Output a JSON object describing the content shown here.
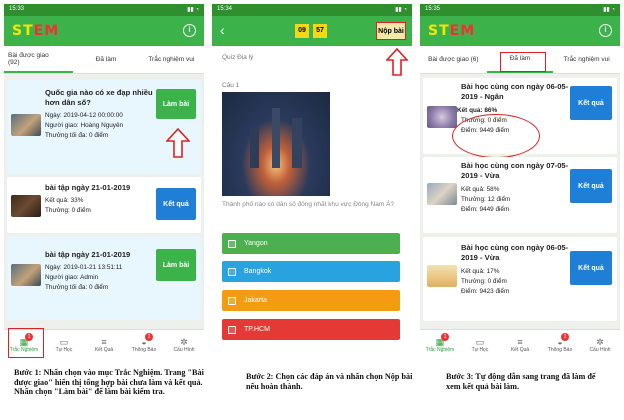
{
  "screen1": {
    "time": "15:33",
    "logo": "STEM",
    "tabs": [
      "Bài được giao\n(92)",
      "Đã làm",
      "Trắc nghiệm vui"
    ],
    "cards": [
      {
        "title": "Quốc gia nào có xe đạp nhiều hơn dân số?",
        "lines": [
          "Ngày: 2019-04-12 00:00:00",
          "Người giao: Hoàng Nguyên",
          "Thưởng tối đa: 0 điểm"
        ],
        "button": "Làm bài"
      },
      {
        "title": "bài tập ngày 21-01-2019",
        "lines": [
          "Kết quả: 33%",
          "Thưởng: 0 điểm"
        ],
        "button": "Kết quả"
      },
      {
        "title": "bài tập ngày 21-01-2019",
        "lines": [
          "Ngày: 2019-01-21 13:51:11",
          "Người giao: Admin",
          "Thưởng tối đa: 0 điểm"
        ],
        "button": "Làm bài"
      }
    ],
    "nav": [
      {
        "label": "Trắc Nghiệm",
        "badge": "1",
        "icon": "quiz-icon"
      },
      {
        "label": "Tự Học",
        "badge": "",
        "icon": "book-icon"
      },
      {
        "label": "Kết Quả",
        "badge": "",
        "icon": "results-icon"
      },
      {
        "label": "Thông Báo",
        "badge": "1",
        "icon": "bell-icon"
      },
      {
        "label": "Cấu Hình",
        "badge": "",
        "icon": "gear-icon"
      }
    ]
  },
  "screen2": {
    "time": "15:34",
    "timer_min": "09",
    "timer_sec": "57",
    "submit": "Nộp bài",
    "subject": "Quiz Địa lý",
    "question_label": "Câu 1",
    "question_text": "Thành phố nào có dân số đông nhất khu vực Đông Nam Á?",
    "answers": [
      {
        "text": "Yangon",
        "color": "#4caf50"
      },
      {
        "text": "Bangkok",
        "color": "#29a3e0"
      },
      {
        "text": "Jakarta",
        "color": "#f39c12"
      },
      {
        "text": "TP.HCM",
        "color": "#e53935"
      }
    ]
  },
  "screen3": {
    "time": "15:35",
    "logo": "STEM",
    "tabs": [
      "Bài được giao (6)",
      "Đã làm",
      "Trắc nghiệm vui"
    ],
    "cards": [
      {
        "title": "Bài học cùng con ngày 06-05-2019 - Ngân",
        "lines": [
          "Kết quả: 86%",
          "Thưởng: 0 điểm",
          "Điểm: 9449 điểm"
        ],
        "button": "Kết quả"
      },
      {
        "title": "Bài học cùng con ngày 07-05-2019 - Vừa",
        "lines": [
          "Kết quả: 58%",
          "Thưởng: 12 điểm",
          "Điểm: 9449 điểm"
        ],
        "button": "Kết quả"
      },
      {
        "title": "Bài học cùng con ngày 06-05-2019 - Vừa",
        "lines": [
          "Kết quả: 17%",
          "Thưởng: 0 điểm",
          "Điểm: 9423 điểm"
        ],
        "button": "Kết quả"
      }
    ],
    "nav": [
      "Trắc Nghiệm",
      "Tự Học",
      "Kết Quả",
      "Thông Báo",
      "Cấu Hình"
    ]
  },
  "captions": {
    "c1": "Bước 1: Nhấn chọn vào mục Trắc Nghiệm. Trang \"Bài được giao\" hiển thị tổng hợp bài chưa làm và kết quả. Nhấn chọn \"Làm bài\" để làm bài kiểm tra.",
    "c2": "Bước 2: Chọn các đáp án và nhấn chọn Nộp bài nếu hoàn thành.",
    "c3": "Bước 3: Tự động dẫn sang trang đã làm để xem kết quả bài làm."
  }
}
